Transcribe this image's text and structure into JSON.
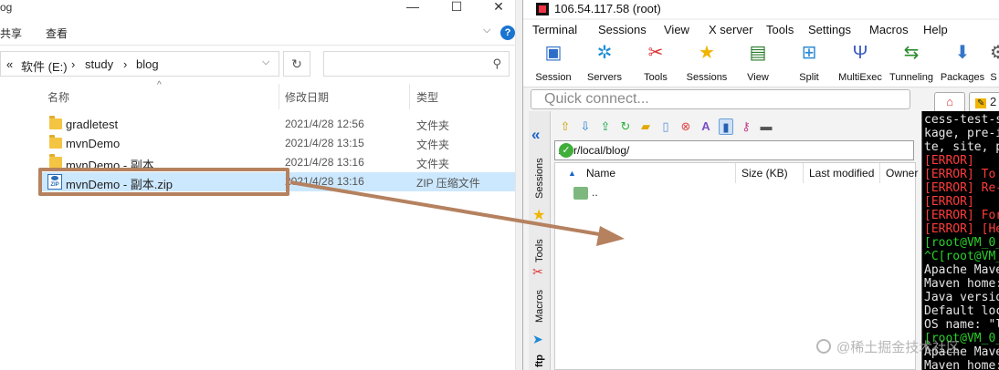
{
  "explorer": {
    "title_fragment": "og",
    "ribbon_tabs": [
      "共享",
      "查看"
    ],
    "help_glyph": "?",
    "breadcrumb": {
      "prefix": "«",
      "items": [
        "软件 (E:)",
        "study",
        "blog"
      ]
    },
    "columns": [
      "名称",
      "修改日期",
      "类型"
    ],
    "files": [
      {
        "name": "gradletest",
        "date": "2021/4/28 12:56",
        "type": "文件夹",
        "icon": "folder-icon"
      },
      {
        "name": "mvnDemo",
        "date": "2021/4/28 13:15",
        "type": "文件夹",
        "icon": "folder-icon"
      },
      {
        "name": "mvnDemo - 副本",
        "date": "2021/4/28 13:16",
        "type": "文件夹",
        "icon": "folder-icon"
      },
      {
        "name": "mvnDemo - 副本.zip",
        "date": "2021/4/28 13:16",
        "type": "ZIP 压缩文件",
        "icon": "zip-icon"
      }
    ],
    "accent": "#b5815f"
  },
  "moba": {
    "title": "106.54.117.58 (root)",
    "menu": [
      "Terminal",
      "Sessions",
      "View",
      "X server",
      "Tools",
      "Settings",
      "Macros",
      "Help"
    ],
    "toolbar": [
      "Session",
      "Servers",
      "Tools",
      "Sessions",
      "View",
      "Split",
      "MultiExec",
      "Tunneling",
      "Packages",
      "S"
    ],
    "quick_connect": "Quick connect...",
    "side_tabs": [
      "Sessions",
      "Tools",
      "Macros",
      "ftp"
    ],
    "path": "/usr/local/blog/",
    "file_columns": [
      "Name",
      "Size (KB)",
      "Last modified",
      "Owner"
    ],
    "parent_dir": "..",
    "term_tab_label": "2",
    "terminal_lines": [
      {
        "text": "cess-test-s",
        "cls": ""
      },
      {
        "text": "kage, pre-i",
        "cls": ""
      },
      {
        "text": "te, site, p",
        "cls": ""
      },
      {
        "text": "[ERROR]",
        "cls": "err"
      },
      {
        "text": "[ERROR] To",
        "cls": "err"
      },
      {
        "text": "[ERROR] Re-",
        "cls": "err"
      },
      {
        "text": "[ERROR]",
        "cls": "err"
      },
      {
        "text": "[ERROR] For",
        "cls": "err"
      },
      {
        "text": "[ERROR] [He",
        "cls": "err"
      },
      {
        "text": "[root@VM_0_",
        "cls": "grn"
      },
      {
        "text": "^C[root@VM_",
        "cls": "grn"
      },
      {
        "text": "Apache Mave",
        "cls": ""
      },
      {
        "text": "Maven home:",
        "cls": ""
      },
      {
        "text": "Java versio",
        "cls": ""
      },
      {
        "text": "Default loc",
        "cls": ""
      },
      {
        "text": "OS name: \"l",
        "cls": ""
      },
      {
        "text": "[root@VM_0_",
        "cls": "grn"
      },
      {
        "text": "Apache Mave",
        "cls": ""
      },
      {
        "text": "Maven home:",
        "cls": ""
      }
    ]
  },
  "watermark": "@稀土掘金技术社区"
}
